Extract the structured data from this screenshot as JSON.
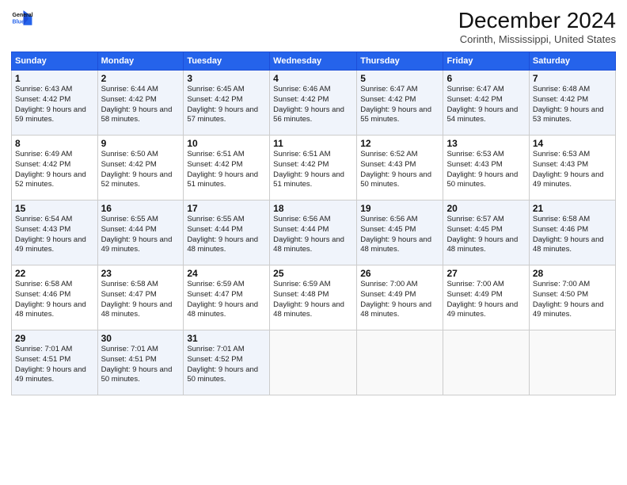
{
  "header": {
    "logo_line1": "General",
    "logo_line2": "Blue",
    "title": "December 2024",
    "subtitle": "Corinth, Mississippi, United States"
  },
  "weekdays": [
    "Sunday",
    "Monday",
    "Tuesday",
    "Wednesday",
    "Thursday",
    "Friday",
    "Saturday"
  ],
  "weeks": [
    [
      {
        "day": "1",
        "sunrise": "6:43 AM",
        "sunset": "4:42 PM",
        "daylight": "9 hours and 59 minutes."
      },
      {
        "day": "2",
        "sunrise": "6:44 AM",
        "sunset": "4:42 PM",
        "daylight": "9 hours and 58 minutes."
      },
      {
        "day": "3",
        "sunrise": "6:45 AM",
        "sunset": "4:42 PM",
        "daylight": "9 hours and 57 minutes."
      },
      {
        "day": "4",
        "sunrise": "6:46 AM",
        "sunset": "4:42 PM",
        "daylight": "9 hours and 56 minutes."
      },
      {
        "day": "5",
        "sunrise": "6:47 AM",
        "sunset": "4:42 PM",
        "daylight": "9 hours and 55 minutes."
      },
      {
        "day": "6",
        "sunrise": "6:47 AM",
        "sunset": "4:42 PM",
        "daylight": "9 hours and 54 minutes."
      },
      {
        "day": "7",
        "sunrise": "6:48 AM",
        "sunset": "4:42 PM",
        "daylight": "9 hours and 53 minutes."
      }
    ],
    [
      {
        "day": "8",
        "sunrise": "6:49 AM",
        "sunset": "4:42 PM",
        "daylight": "9 hours and 52 minutes."
      },
      {
        "day": "9",
        "sunrise": "6:50 AM",
        "sunset": "4:42 PM",
        "daylight": "9 hours and 52 minutes."
      },
      {
        "day": "10",
        "sunrise": "6:51 AM",
        "sunset": "4:42 PM",
        "daylight": "9 hours and 51 minutes."
      },
      {
        "day": "11",
        "sunrise": "6:51 AM",
        "sunset": "4:42 PM",
        "daylight": "9 hours and 51 minutes."
      },
      {
        "day": "12",
        "sunrise": "6:52 AM",
        "sunset": "4:43 PM",
        "daylight": "9 hours and 50 minutes."
      },
      {
        "day": "13",
        "sunrise": "6:53 AM",
        "sunset": "4:43 PM",
        "daylight": "9 hours and 50 minutes."
      },
      {
        "day": "14",
        "sunrise": "6:53 AM",
        "sunset": "4:43 PM",
        "daylight": "9 hours and 49 minutes."
      }
    ],
    [
      {
        "day": "15",
        "sunrise": "6:54 AM",
        "sunset": "4:43 PM",
        "daylight": "9 hours and 49 minutes."
      },
      {
        "day": "16",
        "sunrise": "6:55 AM",
        "sunset": "4:44 PM",
        "daylight": "9 hours and 49 minutes."
      },
      {
        "day": "17",
        "sunrise": "6:55 AM",
        "sunset": "4:44 PM",
        "daylight": "9 hours and 48 minutes."
      },
      {
        "day": "18",
        "sunrise": "6:56 AM",
        "sunset": "4:44 PM",
        "daylight": "9 hours and 48 minutes."
      },
      {
        "day": "19",
        "sunrise": "6:56 AM",
        "sunset": "4:45 PM",
        "daylight": "9 hours and 48 minutes."
      },
      {
        "day": "20",
        "sunrise": "6:57 AM",
        "sunset": "4:45 PM",
        "daylight": "9 hours and 48 minutes."
      },
      {
        "day": "21",
        "sunrise": "6:58 AM",
        "sunset": "4:46 PM",
        "daylight": "9 hours and 48 minutes."
      }
    ],
    [
      {
        "day": "22",
        "sunrise": "6:58 AM",
        "sunset": "4:46 PM",
        "daylight": "9 hours and 48 minutes."
      },
      {
        "day": "23",
        "sunrise": "6:58 AM",
        "sunset": "4:47 PM",
        "daylight": "9 hours and 48 minutes."
      },
      {
        "day": "24",
        "sunrise": "6:59 AM",
        "sunset": "4:47 PM",
        "daylight": "9 hours and 48 minutes."
      },
      {
        "day": "25",
        "sunrise": "6:59 AM",
        "sunset": "4:48 PM",
        "daylight": "9 hours and 48 minutes."
      },
      {
        "day": "26",
        "sunrise": "7:00 AM",
        "sunset": "4:49 PM",
        "daylight": "9 hours and 48 minutes."
      },
      {
        "day": "27",
        "sunrise": "7:00 AM",
        "sunset": "4:49 PM",
        "daylight": "9 hours and 49 minutes."
      },
      {
        "day": "28",
        "sunrise": "7:00 AM",
        "sunset": "4:50 PM",
        "daylight": "9 hours and 49 minutes."
      }
    ],
    [
      {
        "day": "29",
        "sunrise": "7:01 AM",
        "sunset": "4:51 PM",
        "daylight": "9 hours and 49 minutes."
      },
      {
        "day": "30",
        "sunrise": "7:01 AM",
        "sunset": "4:51 PM",
        "daylight": "9 hours and 50 minutes."
      },
      {
        "day": "31",
        "sunrise": "7:01 AM",
        "sunset": "4:52 PM",
        "daylight": "9 hours and 50 minutes."
      },
      null,
      null,
      null,
      null
    ]
  ]
}
